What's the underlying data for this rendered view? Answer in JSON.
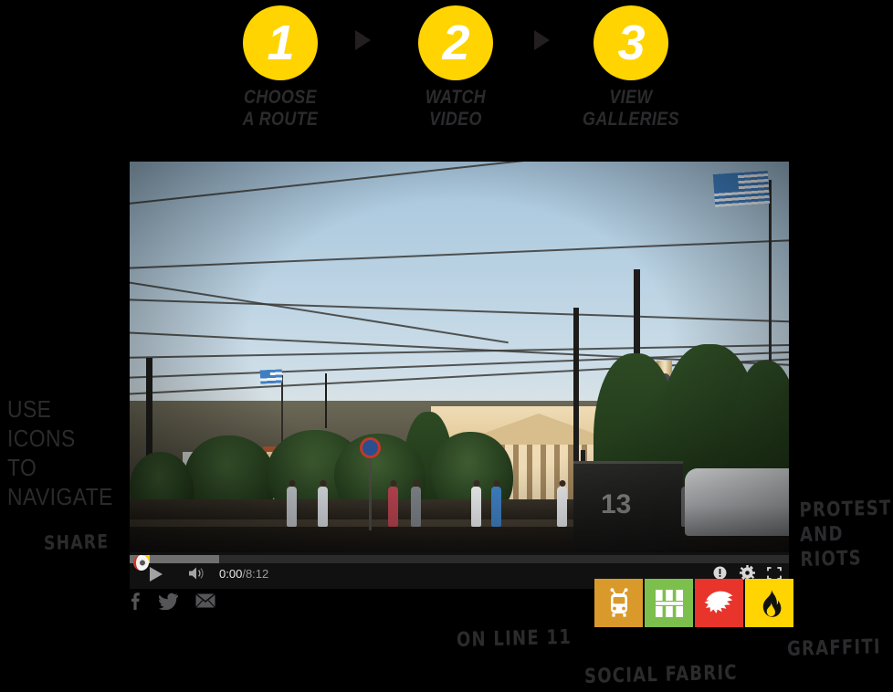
{
  "steps": {
    "items": [
      {
        "number": "1",
        "label": "CHOOSE\nA ROUTE"
      },
      {
        "number": "2",
        "label": "WATCH\nVIDEO"
      },
      {
        "number": "3",
        "label": "VIEW\nGALLERIES"
      }
    ],
    "circle_color": "#FFD400",
    "number_color": "#FFFFFF",
    "label_color": "#2B2B2D",
    "arrow_color": "#231F20"
  },
  "player": {
    "current_time": "0:00",
    "separator": "/",
    "total_time": "8:12",
    "play_label": "play-button",
    "volume_label": "volume-button",
    "info_label": "info-button",
    "settings_label": "settings-button",
    "fullscreen_label": "fullscreen-button",
    "progress_played_color": "#FFCC00",
    "progress_loaded_color": "#6F6F6F",
    "bar_color": "#111111"
  },
  "share": {
    "icons": [
      {
        "name": "facebook-share-icon",
        "glyph": "f"
      },
      {
        "name": "twitter-share-icon",
        "glyph": "twitter-bird"
      },
      {
        "name": "email-share-icon",
        "glyph": "envelope"
      }
    ]
  },
  "categories": [
    {
      "name": "trolleybus",
      "color": "#D99A2B",
      "icon_color": "#FFFFFF"
    },
    {
      "name": "social-fabric",
      "color": "#7DBF4C",
      "icon_color": "#FFFFFF"
    },
    {
      "name": "protests-and-riots",
      "color": "#E8342A",
      "icon_color": "#FFFFFF"
    },
    {
      "name": "graffiti",
      "color": "#FFD400",
      "icon_color": "#111111"
    }
  ],
  "annotations": {
    "use_icons": "USE\nICONS\nTO\nNAVIGATE",
    "share": "SHARE",
    "protests": "PROTESTS\nAND\nRIOTS",
    "graffiti": "GRAFFITI",
    "online11": "ON  LINE  11",
    "social_fabric": "SOCIAL  FABRIC"
  },
  "video_scene": {
    "description": "Academy of Athens at golden hour with Athena column, Greek flags, trolley wires, trees, pedestrians and a white van"
  }
}
